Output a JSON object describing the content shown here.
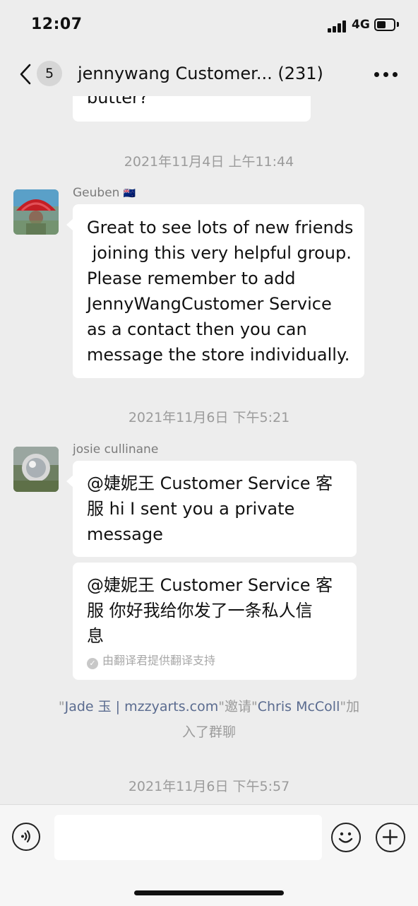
{
  "status_bar": {
    "time": "12:07",
    "network": "4G",
    "battery_percent": 40
  },
  "nav": {
    "unread_count": "5",
    "title": "jennywang   Customer...  (231)"
  },
  "messages": {
    "prev_bubble_text": "butter?",
    "ts1": "2021年11月4日 上午11:44",
    "geuben": {
      "sender": "Geuben",
      "flag": "🇳🇿",
      "lines": [
        "Great to see lots of new friends",
        " joining this very helpful group.",
        "Please remember to add",
        "JennyWangCustomer Service",
        "as a contact then you can",
        "message the store individually."
      ]
    },
    "ts2": "2021年11月6日 下午5:21",
    "josie": {
      "sender": "josie cullinane",
      "msg1_lines": [
        "@婕妮王 Customer Service 客",
        "服 hi I sent you a private",
        "message"
      ],
      "msg2_lines": [
        "@婕妮王 Customer Service 客",
        "服 你好我给你发了一条私人信",
        "息"
      ],
      "translate_note": "由翻译君提供翻译支持"
    },
    "system": {
      "quote1": "\"",
      "inviter": "Jade 玉 | mzzyarts.com",
      "middle": "\"邀请\"",
      "invitee": "Chris McColl",
      "end_line1": "\"加",
      "end_line2": "入了群聊"
    },
    "ts3": "2021年11月6日 下午5:57"
  },
  "input": {
    "placeholder": ""
  }
}
